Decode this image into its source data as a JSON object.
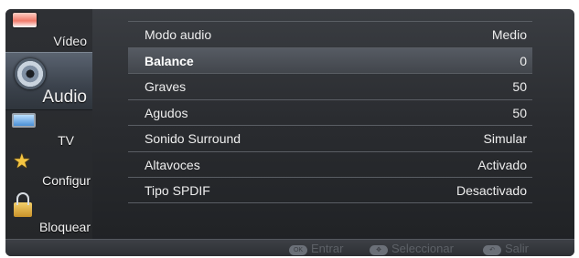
{
  "sidebar": {
    "items": [
      {
        "label": "Vídeo",
        "icon": "video-icon"
      },
      {
        "label": "Audio",
        "icon": "speaker-icon",
        "active": true
      },
      {
        "label": "TV",
        "icon": "tv-icon"
      },
      {
        "label": "Configur",
        "icon": "star-icon"
      },
      {
        "label": "Bloquear",
        "icon": "lock-icon"
      }
    ]
  },
  "settings": {
    "rows": [
      {
        "name": "Modo audio",
        "value": "Medio"
      },
      {
        "name": "Balance",
        "value": "0",
        "selected": true
      },
      {
        "name": "Graves",
        "value": "50"
      },
      {
        "name": "Agudos",
        "value": "50"
      },
      {
        "name": "Sonido Surround",
        "value": "Simular"
      },
      {
        "name": "Altavoces",
        "value": "Activado"
      },
      {
        "name": "Tipo SPDIF",
        "value": "Desactivado"
      }
    ]
  },
  "hints": {
    "enter": {
      "button": "OK",
      "label": "Entrar"
    },
    "select": {
      "button": "✥",
      "label": "Seleccionar"
    },
    "exit": {
      "button": "↶",
      "label": "Salir"
    }
  },
  "colors": {
    "panel": "#2a2c30",
    "highlight": "#565b63",
    "text": "#eeeeee",
    "hint_text": "#5c6066"
  }
}
